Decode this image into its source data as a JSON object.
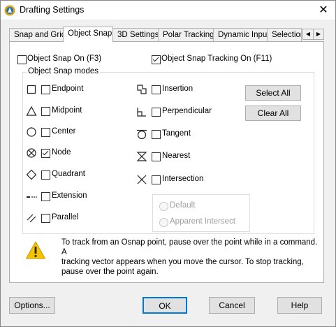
{
  "window": {
    "title": "Drafting Settings",
    "close_glyph": "✕"
  },
  "tabs": [
    {
      "label": "Snap and Grid"
    },
    {
      "label": "Object Snap"
    },
    {
      "label": "3D Settings"
    },
    {
      "label": "Polar Tracking"
    },
    {
      "label": "Dynamic Input"
    },
    {
      "label": "Selection"
    }
  ],
  "tab_scroll": {
    "left": "◀",
    "right": "▶"
  },
  "object_snap_on": {
    "label": "Object Snap On (F3)",
    "checked": false
  },
  "object_snap_tracking_on": {
    "label": "Object Snap Tracking On (F11)",
    "checked": true
  },
  "modes_group_title": "Object Snap modes",
  "modes_left": [
    {
      "label": "Endpoint",
      "icon": "endpoint-icon",
      "checked": false
    },
    {
      "label": "Midpoint",
      "icon": "midpoint-icon",
      "checked": false
    },
    {
      "label": "Center",
      "icon": "center-icon",
      "checked": false
    },
    {
      "label": "Node",
      "icon": "node-icon",
      "checked": true
    },
    {
      "label": "Quadrant",
      "icon": "quadrant-icon",
      "checked": false
    },
    {
      "label": "Extension",
      "icon": "extension-icon",
      "checked": false
    },
    {
      "label": "Parallel",
      "icon": "parallel-icon",
      "checked": false
    }
  ],
  "modes_right": [
    {
      "label": "Insertion",
      "icon": "insertion-icon",
      "checked": false
    },
    {
      "label": "Perpendicular",
      "icon": "perpendicular-icon",
      "checked": false
    },
    {
      "label": "Tangent",
      "icon": "tangent-icon",
      "checked": false
    },
    {
      "label": "Nearest",
      "icon": "nearest-icon",
      "checked": false
    },
    {
      "label": "Intersection",
      "icon": "intersection-icon",
      "checked": false
    }
  ],
  "select_all_label": "Select All",
  "clear_all_label": "Clear All",
  "radio_options": [
    {
      "label": "Default",
      "enabled": false
    },
    {
      "label": "Apparent Intersect",
      "enabled": false
    }
  ],
  "info_icon": "warning-icon",
  "info_text": [
    "To track from an Osnap point, pause over the point while in a command. A",
    "tracking vector appears when you move the cursor. To stop tracking,",
    "pause over the point again."
  ],
  "footer": {
    "options": "Options...",
    "ok": "OK",
    "cancel": "Cancel",
    "help": "Help"
  },
  "colors": {
    "dialog_bg": "#f0f0f0",
    "panel_bg": "#ffffff",
    "button_bg": "#e1e1e1",
    "warning": "#f4c400"
  }
}
